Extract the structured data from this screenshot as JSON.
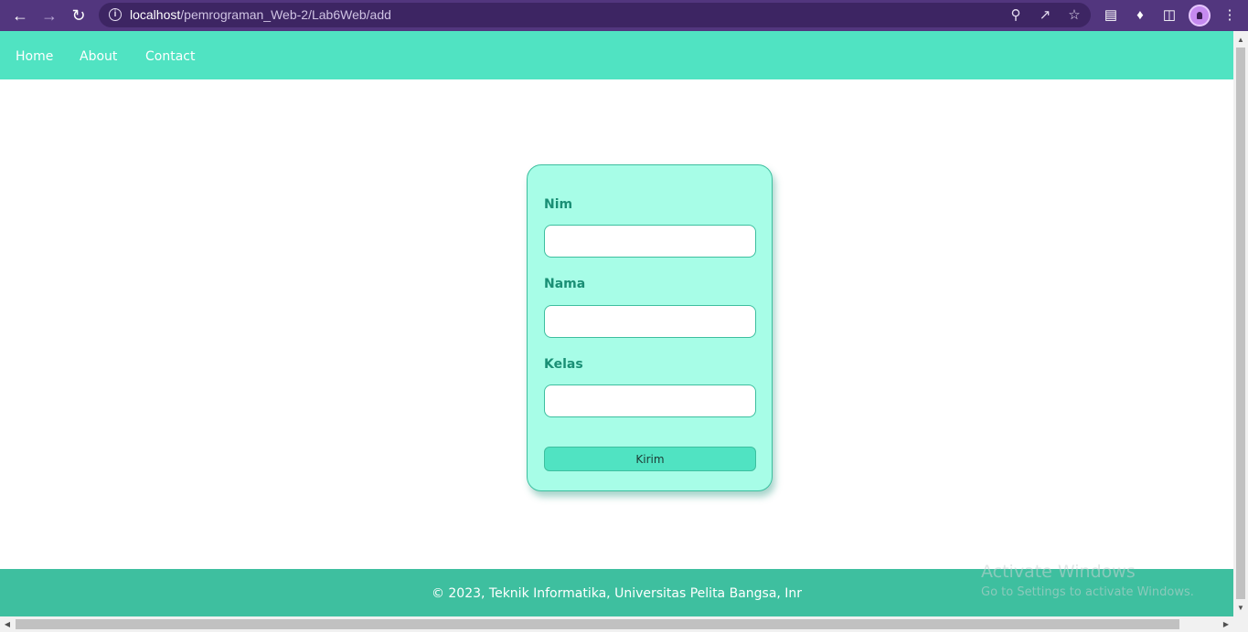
{
  "browser": {
    "url_host": "localhost",
    "url_path": "/pemrograman_Web-2/Lab6Web/add"
  },
  "nav": {
    "items": [
      {
        "label": "Home"
      },
      {
        "label": "About"
      },
      {
        "label": "Contact"
      }
    ]
  },
  "form": {
    "fields": [
      {
        "label": "Nim",
        "value": ""
      },
      {
        "label": "Nama",
        "value": ""
      },
      {
        "label": "Kelas",
        "value": ""
      }
    ],
    "submit_label": "Kirim"
  },
  "footer": {
    "text": "© 2023, Teknik Informatika, Universitas Pelita Bangsa, Inr"
  },
  "watermark": {
    "title": "Activate Windows",
    "subtitle": "Go to Settings to activate Windows."
  },
  "colors": {
    "browser_frame": "#52367e",
    "nav_bg": "#50e3c2",
    "card_bg": "#a7fde7",
    "label_text": "#1a8f75",
    "footer_bg": "#3ebf9f"
  }
}
